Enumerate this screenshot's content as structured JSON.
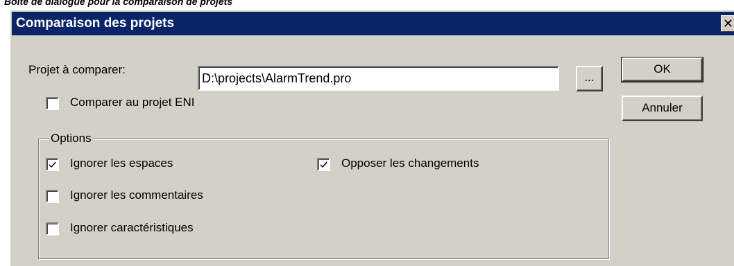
{
  "caption": "Boîte de dialogue pour la comparaison de projets",
  "window": {
    "title": "Comparaison des projets",
    "close_glyph": "✕"
  },
  "project_field": {
    "label": "Projet à comparer:",
    "value": "D:\\projects\\AlarmTrend.pro",
    "browse_label": "..."
  },
  "eni_checkbox": {
    "label": "Comparer au projet ENI",
    "checked": false
  },
  "options": {
    "group_label": "Options",
    "items": [
      {
        "label": "Ignorer les espaces",
        "checked": true
      },
      {
        "label": "Ignorer les commentaires",
        "checked": false
      },
      {
        "label": "Ignorer caractéristiques",
        "checked": false
      },
      {
        "label": "Opposer les changements",
        "checked": true
      }
    ]
  },
  "buttons": {
    "ok_label": "OK",
    "cancel_label": "Annuler"
  },
  "icons": {
    "close": "close-icon",
    "check": "checkmark-icon"
  },
  "colors": {
    "titlebar": "#0a246a",
    "face": "#d4d0c8"
  }
}
